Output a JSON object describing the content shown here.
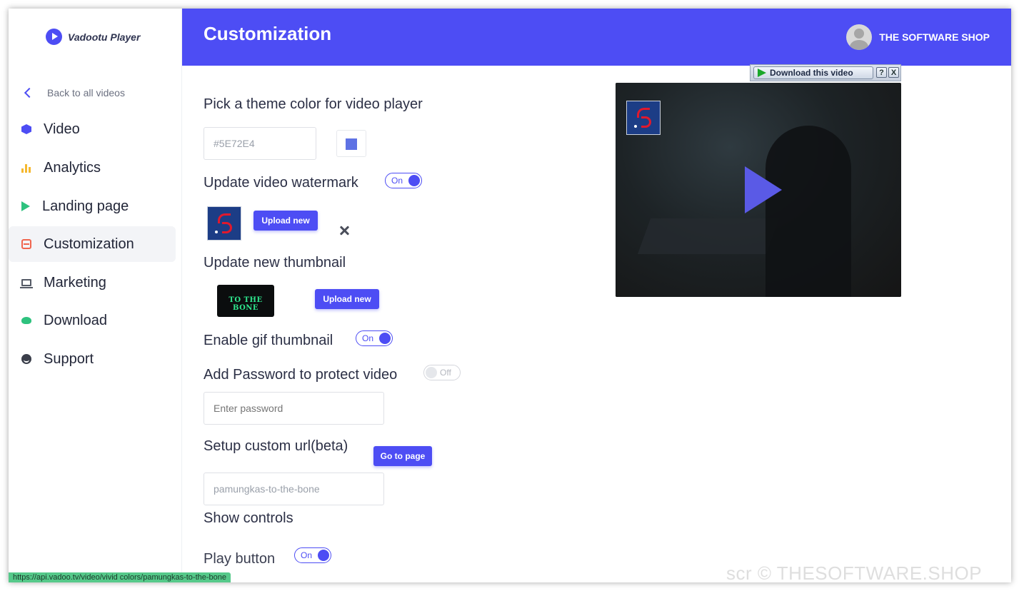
{
  "app": {
    "name": "Vadootu Player"
  },
  "sidebar": {
    "back_label": "Back to all videos",
    "items": [
      {
        "label": "Video",
        "icon": "cube-icon",
        "color": "#4d4df4"
      },
      {
        "label": "Analytics",
        "icon": "bar-chart-icon",
        "color": "#f5b82e"
      },
      {
        "label": "Landing page",
        "icon": "play-icon",
        "color": "#2ec27e"
      },
      {
        "label": "Customization",
        "icon": "customization-icon",
        "color": "#f0654e",
        "active": true
      },
      {
        "label": "Marketing",
        "icon": "laptop-icon",
        "color": "#555a66"
      },
      {
        "label": "Download",
        "icon": "cloud-download-icon",
        "color": "#2ec27e"
      },
      {
        "label": "Support",
        "icon": "smile-icon",
        "color": "#3a3e4a"
      }
    ]
  },
  "header": {
    "title": "Customization",
    "user_name": "THE SOFTWARE SHOP",
    "background": "#4d4df4"
  },
  "theme": {
    "title": "Pick a theme color for video player",
    "color_value": "#5E72E4",
    "swatch_color": "#5e72e4"
  },
  "watermark": {
    "title": "Update video watermark",
    "toggle": "On",
    "upload_label": "Upload new"
  },
  "thumbnail": {
    "title": "Update new thumbnail",
    "thumb_text": "TO THE BONE",
    "upload_label": "Upload new"
  },
  "gif": {
    "title": "Enable gif thumbnail",
    "toggle": "On"
  },
  "password": {
    "title": "Add Password to protect video",
    "toggle": "Off",
    "placeholder": "Enter password"
  },
  "custom_url": {
    "title": "Setup custom url(beta)",
    "button": "Go to page",
    "value": "pamungkas-to-the-bone"
  },
  "controls": {
    "title": "Show controls",
    "play_button_label": "Play button",
    "play_button_toggle": "On"
  },
  "download_bar": {
    "label": "Download this video",
    "help": "?",
    "close": "X"
  },
  "status_bar": {
    "url": "https://api.vadoo.tv/video/vivid colors/pamungkas-to-the-bone"
  },
  "screen_watermark": "scr © THESOFTWARE.SHOP"
}
